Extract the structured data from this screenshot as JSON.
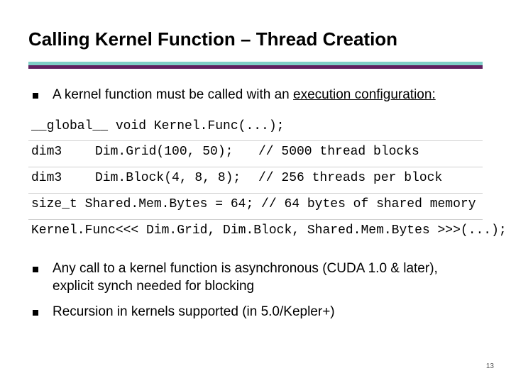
{
  "title": "Calling Kernel Function – Thread Creation",
  "bullets_top": [
    {
      "pre": "A kernel function must be called with an ",
      "underlined": "execution configuration:"
    }
  ],
  "code": {
    "line0": "__global__ void Kernel.Func(...);",
    "row1": {
      "type": "dim3",
      "decl": "Dim.Grid(100, 50);",
      "comment": "// 5000 thread blocks"
    },
    "row2": {
      "type": "dim3",
      "decl": "Dim.Block(4, 8, 8);",
      "comment": "// 256 threads per block"
    },
    "line3": "size_t Shared.Mem.Bytes = 64; // 64 bytes of shared memory",
    "line4": "Kernel.Func<<< Dim.Grid, Dim.Block, Shared.Mem.Bytes >>>(...);"
  },
  "bullets_bottom": [
    "Any call to a kernel function is asynchronous (CUDA 1.0 & later), explicit synch needed for blocking",
    "Recursion in kernels supported (in 5.0/Kepler+)"
  ],
  "page_number": "13"
}
